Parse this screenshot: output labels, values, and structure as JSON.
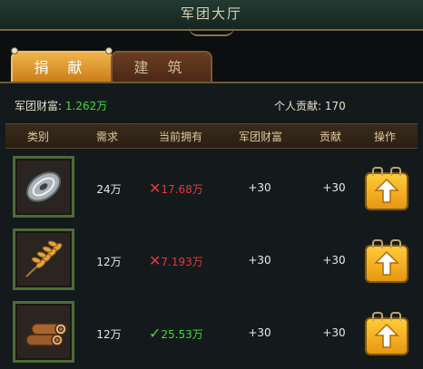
{
  "window": {
    "title": "军团大厅"
  },
  "tabs": [
    {
      "label": "捐 献",
      "active": true
    },
    {
      "label": "建 筑",
      "active": false
    }
  ],
  "stats": {
    "wealth_label": "军团财富:",
    "wealth_value": "1.262万",
    "contribution_label": "个人贡献:",
    "contribution_value": "170"
  },
  "columns": [
    "类别",
    "需求",
    "当前拥有",
    "军团财富",
    "贡献",
    "操作"
  ],
  "rows": [
    {
      "item": "silver-coin",
      "need": "24万",
      "owned": "17.68万",
      "owned_status": "insufficient",
      "wealth": "+30",
      "contrib": "+30"
    },
    {
      "item": "wheat",
      "need": "12万",
      "owned": "7.193万",
      "owned_status": "insufficient",
      "wealth": "+30",
      "contrib": "+30"
    },
    {
      "item": "wood-logs",
      "need": "12万",
      "owned": "25.53万",
      "owned_status": "sufficient",
      "wealth": "+30",
      "contrib": "+30"
    }
  ],
  "colors": {
    "insufficient": "#e23a3a",
    "sufficient": "#3fdc3a",
    "button": "#f3ae24"
  }
}
